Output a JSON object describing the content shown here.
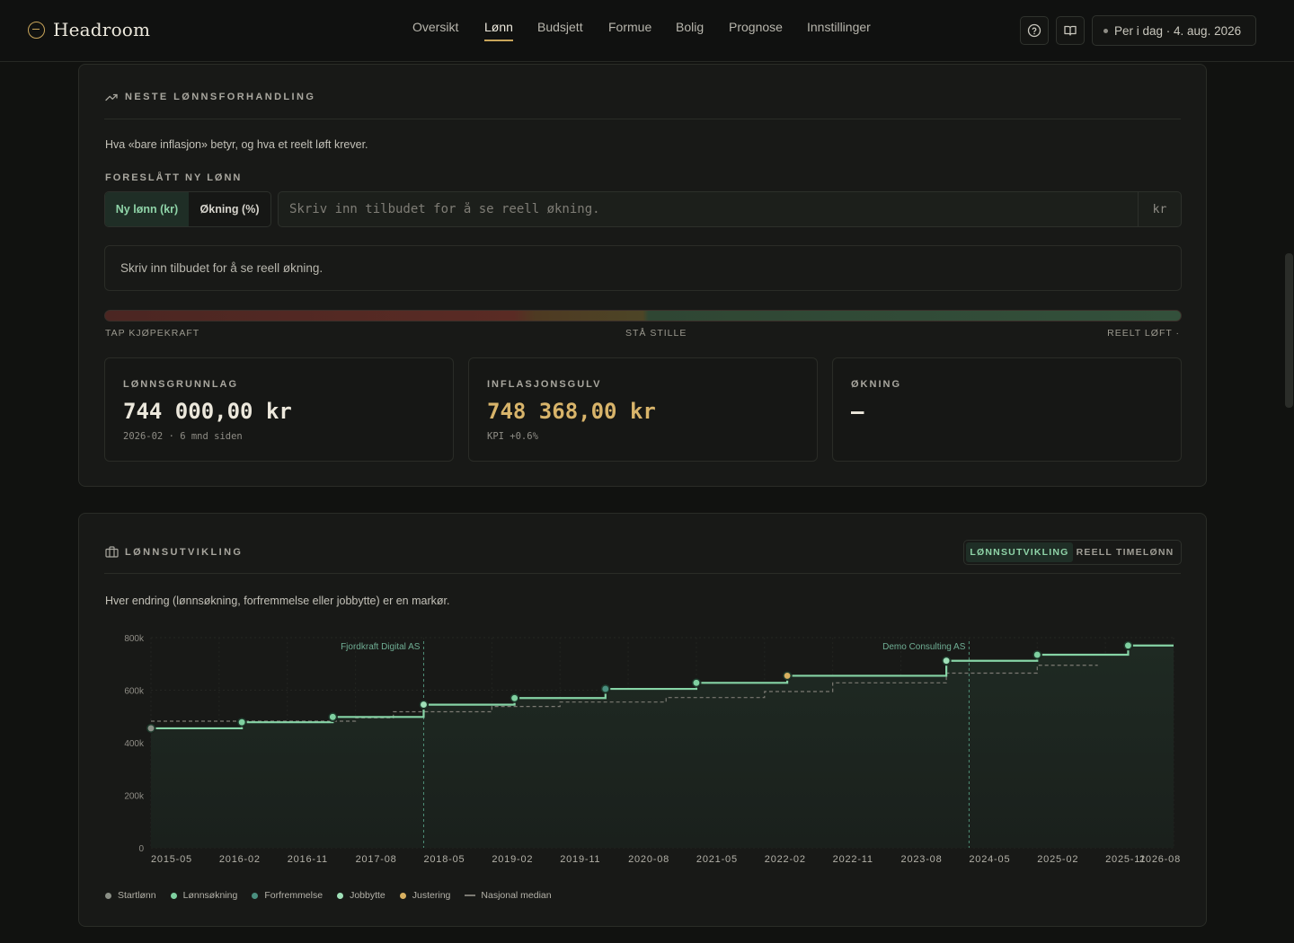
{
  "app": {
    "name": "Headroom"
  },
  "nav": [
    "Oversikt",
    "Lønn",
    "Budsjett",
    "Formue",
    "Bolig",
    "Prognose",
    "Innstillinger"
  ],
  "nav_active": "Lønn",
  "header": {
    "date_label": "Per i dag · 4. aug. 2026",
    "help_icon": "help-circle-icon",
    "book_icon": "book-open-icon"
  },
  "negotiation": {
    "title": "NESTE LØNNSFORHANDLING",
    "intro": "Hva «bare inflasjon» betyr, og hva et reelt løft krever.",
    "proposed_label": "FORESLÅTT NY LØNN",
    "mode_options": [
      "Ny lønn (kr)",
      "Økning (%)"
    ],
    "mode_selected": "Ny lønn (kr)",
    "offer_value": "",
    "offer_placeholder": "Skriv inn tilbudet for å se reell økning.",
    "offer_unit": "kr",
    "message": "Skriv inn tilbudet for å se reell økning.",
    "scale_labels": [
      "TAP KJØPEKRAFT",
      "STÅ STILLE",
      "REELT LØFT ·"
    ],
    "stats": [
      {
        "title": "LØNNSGRUNNLAG",
        "value": "744 000,00 kr",
        "note": "2026-02 · 6 mnd siden"
      },
      {
        "title": "INFLASJONSGULV",
        "value": "748 368,00 kr",
        "note": "KPI +0.6%"
      },
      {
        "title": "ØKNING",
        "value": "–",
        "note": ""
      }
    ]
  },
  "development": {
    "title": "LØNNSUTVIKLING",
    "toggle_options": [
      "LØNNSUTVIKLING",
      "REELL TIMELØNN"
    ],
    "toggle_selected": "LØNNSUTVIKLING",
    "intro": "Hver endring (lønnsøkning, forfremmelse eller jobbytte) er en markør.",
    "legend": [
      {
        "label": "Startlønn",
        "color": "#8a8f86"
      },
      {
        "label": "Lønnsøkning",
        "color": "#7fd0a0"
      },
      {
        "label": "Forfremmelse",
        "color": "#4a8f7f"
      },
      {
        "label": "Jobbytte",
        "color": "#9fe0b8"
      },
      {
        "label": "Justering",
        "color": "#d8b060"
      },
      {
        "label": "Nasjonal median",
        "color": "#7c7a73"
      }
    ]
  },
  "chart_data": {
    "type": "line",
    "xlabel": "",
    "ylabel": "",
    "ylim": [
      0,
      800000
    ],
    "y_ticks": [
      "0",
      "200k",
      "400k",
      "600k",
      "800k"
    ],
    "x_ticks": [
      "2015-05",
      "2016-02",
      "2016-11",
      "2017-08",
      "2018-05",
      "2019-02",
      "2019-11",
      "2020-08",
      "2021-05",
      "2022-02",
      "2022-11",
      "2023-08",
      "2024-05",
      "2025-02",
      "2025-11",
      "2026-08"
    ],
    "series": [
      {
        "name": "Lønnsutvikling",
        "step": true,
        "points": [
          {
            "x": "2015-05",
            "y": 455000,
            "event": "Startlønn"
          },
          {
            "x": "2016-05",
            "y": 478000,
            "event": "Lønnsøkning"
          },
          {
            "x": "2017-05",
            "y": 498000,
            "event": "Lønnsøkning"
          },
          {
            "x": "2018-05",
            "y": 545000,
            "event": "Jobbytte"
          },
          {
            "x": "2019-05",
            "y": 570000,
            "event": "Lønnsøkning"
          },
          {
            "x": "2020-05",
            "y": 605000,
            "event": "Forfremmelse"
          },
          {
            "x": "2021-05",
            "y": 628000,
            "event": "Lønnsøkning"
          },
          {
            "x": "2022-05",
            "y": 655000,
            "event": "Justering"
          },
          {
            "x": "2024-02",
            "y": 712000,
            "event": "Jobbytte"
          },
          {
            "x": "2025-02",
            "y": 735000,
            "event": "Lønnsøkning"
          },
          {
            "x": "2026-02",
            "y": 770000,
            "event": "Lønnsøkning"
          }
        ],
        "end_x": "2026-08"
      },
      {
        "name": "Nasjonal median",
        "step": true,
        "dashed": true,
        "points": [
          {
            "x": "2015-05",
            "y": 482000
          },
          {
            "x": "2017-08",
            "y": 495000
          },
          {
            "x": "2018-01",
            "y": 518000
          },
          {
            "x": "2019-02",
            "y": 538000
          },
          {
            "x": "2019-11",
            "y": 555000
          },
          {
            "x": "2021-01",
            "y": 572000
          },
          {
            "x": "2022-02",
            "y": 595000
          },
          {
            "x": "2022-11",
            "y": 628000
          },
          {
            "x": "2024-02",
            "y": 665000
          },
          {
            "x": "2025-02",
            "y": 695000
          }
        ],
        "end_x": "2025-10"
      }
    ],
    "annotations": [
      {
        "x": "2018-05",
        "label": "Fjordkraft Digital AS"
      },
      {
        "x": "2024-05",
        "label": "Demo Consulting AS"
      }
    ],
    "grid": true,
    "legend_position": "bottom-left"
  }
}
